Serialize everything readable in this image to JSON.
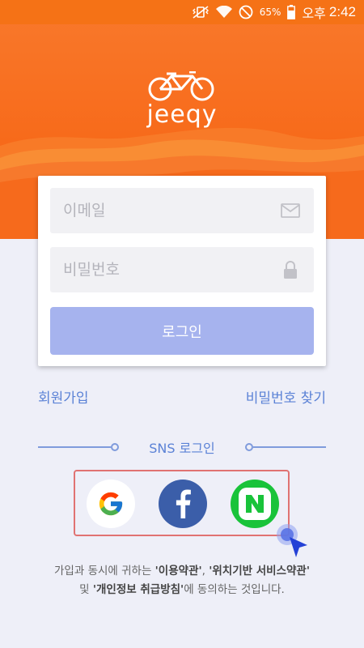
{
  "status_bar": {
    "battery_percent": "65%",
    "ampm": "오후",
    "time": "2:42",
    "icons": [
      "vibrate-mute-icon",
      "wifi-icon",
      "do-not-disturb-icon",
      "battery-icon"
    ]
  },
  "brand": {
    "logo_text": "jeeqy",
    "accent_color": "#f57216"
  },
  "login_form": {
    "email_placeholder": "이메일",
    "password_placeholder": "비밀번호",
    "login_label": "로그인",
    "login_color": "#a6b3ee"
  },
  "links": {
    "signup": "회원가입",
    "find_password": "비밀번호 찾기"
  },
  "sns": {
    "label": "SNS 로그인",
    "providers": [
      "google",
      "facebook",
      "naver"
    ]
  },
  "terms": {
    "line1_pre": "가입과 동시에 귀하는 ",
    "terms_of_use": "'이용약관'",
    "sep": ", ",
    "location_terms": "'위치기반 서비스약관'",
    "line2_pre": "및 ",
    "privacy_policy": "'개인정보 취급방침'",
    "line2_post": "에 동의하는 것입니다."
  }
}
